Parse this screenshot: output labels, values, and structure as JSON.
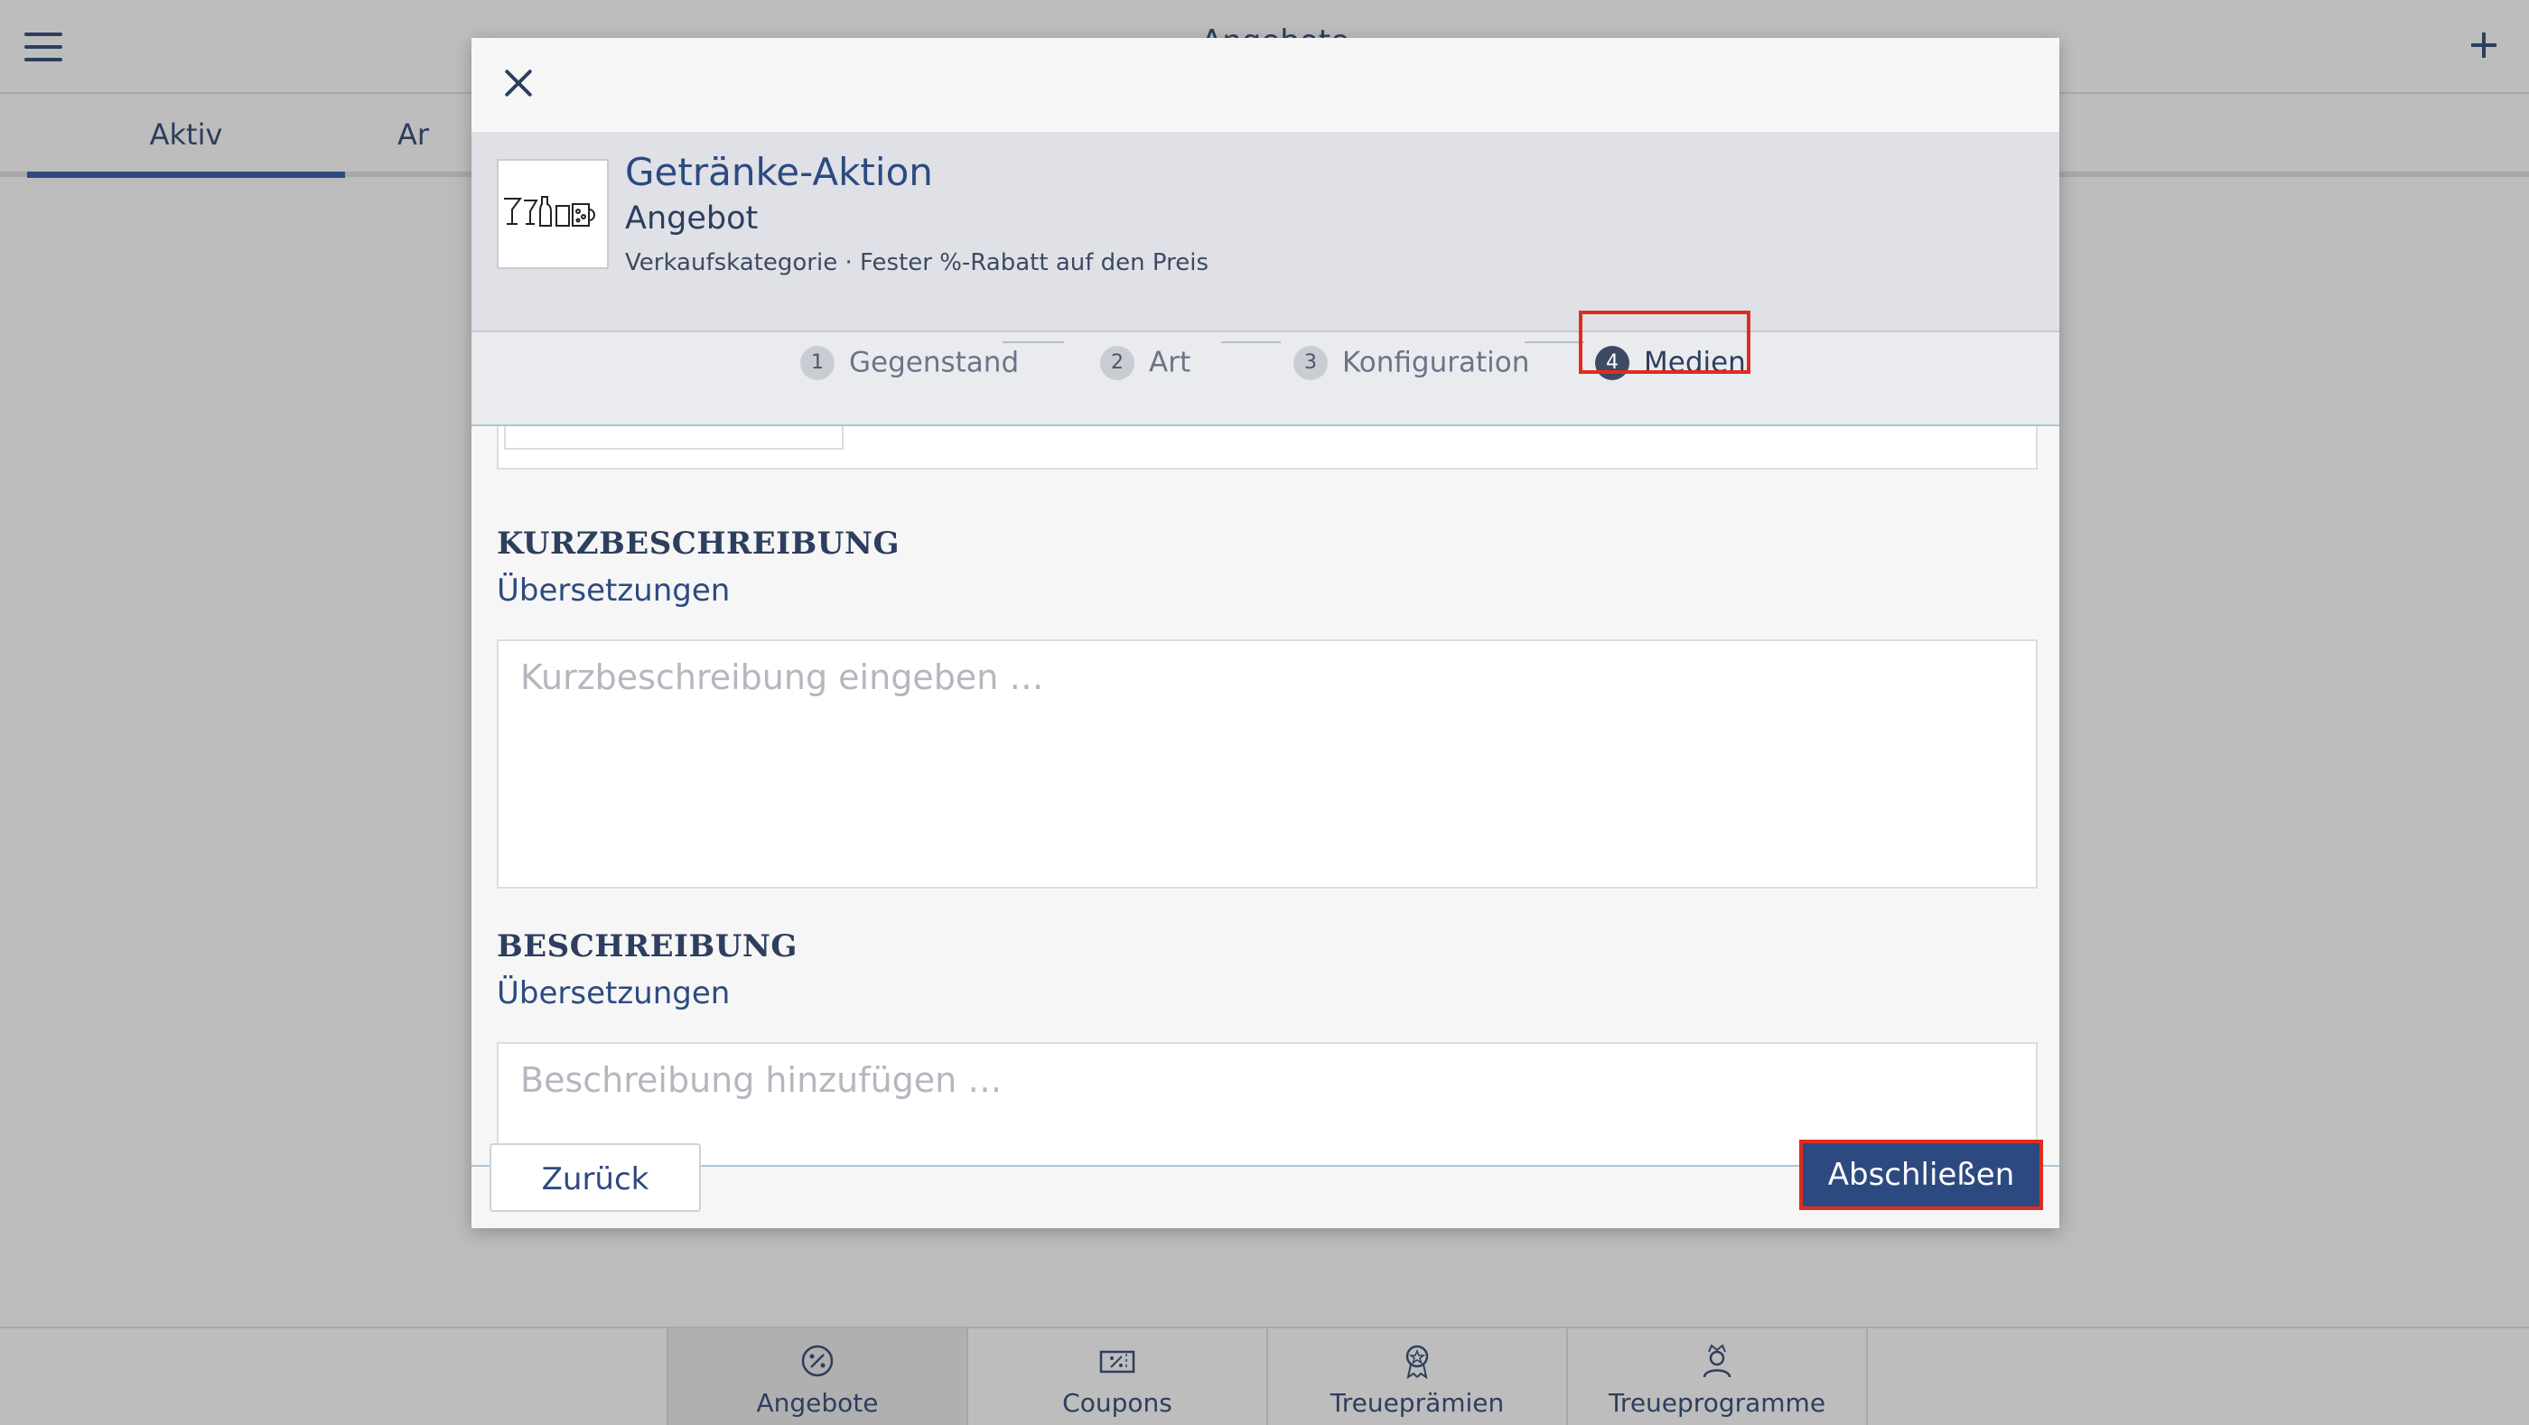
{
  "app": {
    "page_title": "Angebote",
    "tabs": [
      {
        "label": "Aktiv",
        "active": true
      },
      {
        "label": "Ar"
      }
    ]
  },
  "bottom_nav": {
    "items": [
      {
        "label": "Angebote",
        "icon": "percent-badge-icon",
        "active": true
      },
      {
        "label": "Coupons",
        "icon": "coupon-icon"
      },
      {
        "label": "Treueprämien",
        "icon": "award-icon"
      },
      {
        "label": "Treueprogramme",
        "icon": "crown-person-icon"
      }
    ]
  },
  "modal": {
    "product": {
      "title": "Getränke-Aktion",
      "subtitle": "Angebot",
      "meta": "Verkaufskategorie · Fester %-Rabatt auf den Preis"
    },
    "steps": [
      {
        "num": "1",
        "label": "Gegenstand"
      },
      {
        "num": "2",
        "label": "Art"
      },
      {
        "num": "3",
        "label": "Konfiguration"
      },
      {
        "num": "4",
        "label": "Medien",
        "active": true
      }
    ],
    "short_description": {
      "heading": "KURZBESCHREIBUNG",
      "translations_link": "Übersetzungen",
      "placeholder": "Kurzbeschreibung eingeben …"
    },
    "description": {
      "heading": "BESCHREIBUNG",
      "translations_link": "Übersetzungen",
      "placeholder": "Beschreibung hinzufügen …"
    },
    "footer": {
      "back_label": "Zurück",
      "finish_label": "Abschließen"
    }
  },
  "colors": {
    "primary": "#2d4a80",
    "highlight": "#e02b1e"
  }
}
